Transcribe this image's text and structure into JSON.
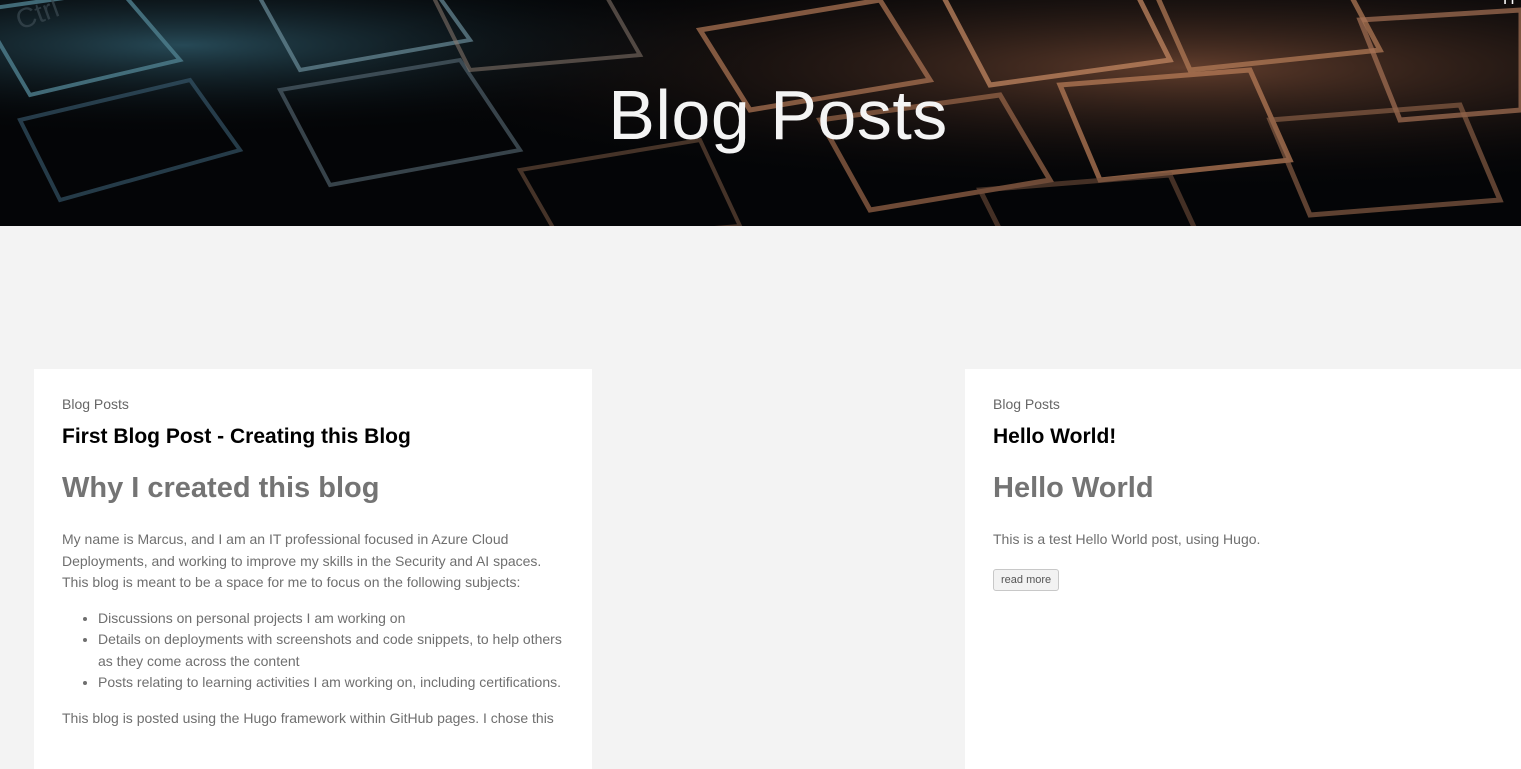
{
  "header": {
    "title": "Blog Posts",
    "corner_nav": "H"
  },
  "posts": [
    {
      "category": "Blog Posts",
      "title": "First Blog Post - Creating this Blog",
      "heading": "Why I created this blog",
      "paragraphs": [
        "My name is Marcus, and I am an IT professional focused in Azure Cloud Deployments, and working to improve my skills in the Security and AI spaces. This blog is meant to be a space for me to focus on the following subjects:",
        "This blog is posted using the Hugo framework within GitHub pages. I chose this"
      ],
      "bullets": [
        "Discussions on personal projects I am working on",
        "Details on deployments with screenshots and code snippets, to help others as they come across the content",
        "Posts relating to learning activities I am working on, including certifications."
      ]
    },
    {
      "category": "Blog Posts",
      "title": "Hello World!",
      "heading": "Hello World",
      "paragraphs": [
        "This is a test Hello World post, using Hugo."
      ],
      "read_more": "read more"
    }
  ],
  "colors": {
    "page_bg": "#f3f3f3",
    "card_bg": "#ffffff",
    "heading": "#747474",
    "title": "#000000"
  }
}
